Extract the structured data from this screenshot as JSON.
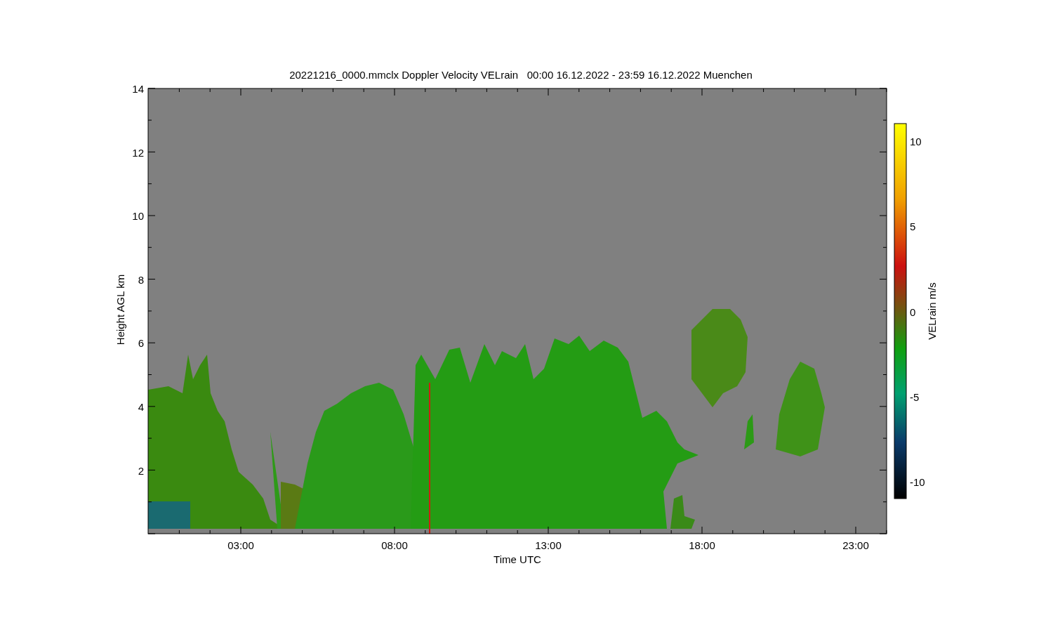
{
  "chart": {
    "title": "20221216_0000.mmclx Doppler Velocity VELrain   00:00 16.12.2022 - 23:59 16.12.2022 Muenchen",
    "xlabel": "Time UTC",
    "ylabel": "Height AGL km",
    "xticks": [
      "03:00",
      "08:00",
      "13:00",
      "18:00",
      "23:00"
    ],
    "yticks": [
      "14",
      "12",
      "10",
      "8",
      "6",
      "4",
      "2"
    ],
    "colorbar": {
      "label": "VELrain m/s",
      "ticks": [
        "10",
        "5",
        "0",
        "-5",
        "-10"
      ]
    }
  }
}
